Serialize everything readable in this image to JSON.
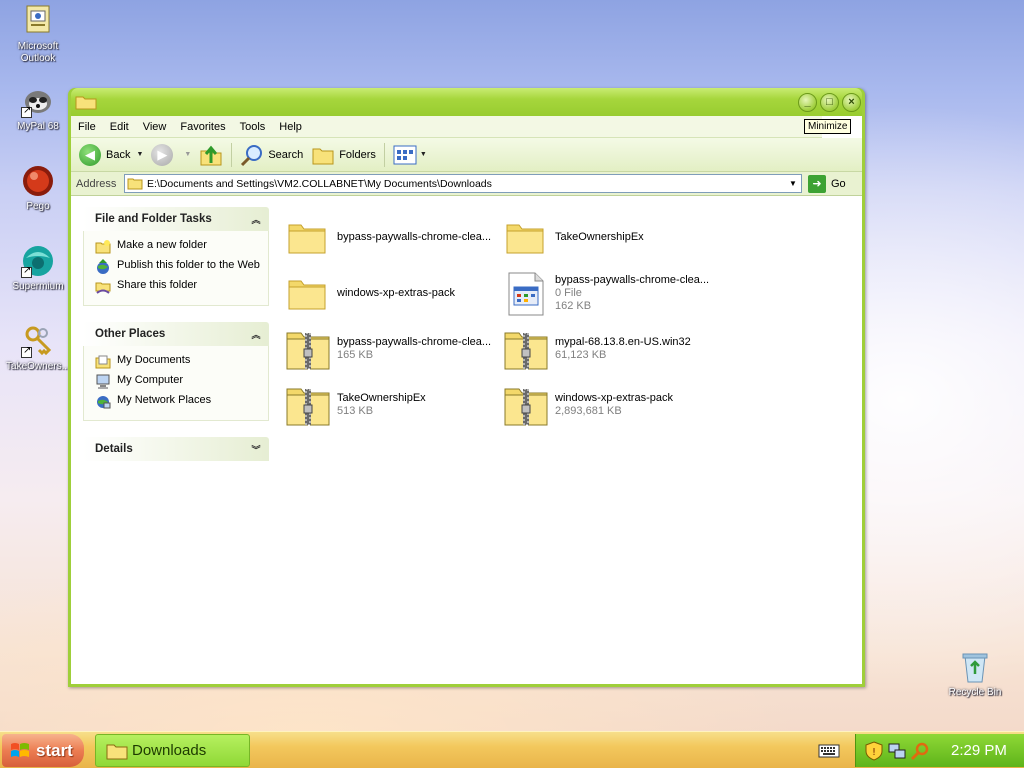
{
  "desktop": {
    "icons": [
      {
        "label": "Microsoft Outlook"
      },
      {
        "label": "MyPal 68"
      },
      {
        "label": "Pego"
      },
      {
        "label": "Supermium"
      },
      {
        "label": "TakeOwners..."
      },
      {
        "label": "Recycle Bin"
      }
    ]
  },
  "window": {
    "title": "",
    "tooltip": "Minimize",
    "menu": [
      "File",
      "Edit",
      "View",
      "Favorites",
      "Tools",
      "Help"
    ],
    "toolbar": {
      "back": "Back",
      "search": "Search",
      "folders": "Folders"
    },
    "address": {
      "label": "Address",
      "value": "E:\\Documents and Settings\\VM2.COLLABNET\\My Documents\\Downloads",
      "go": "Go"
    }
  },
  "taskpane": {
    "file_tasks": {
      "title": "File and Folder Tasks",
      "items": [
        "Make a new folder",
        "Publish this folder to the Web",
        "Share this folder"
      ]
    },
    "other_places": {
      "title": "Other Places",
      "items": [
        "My Documents",
        "My Computer",
        "My Network Places"
      ]
    },
    "details": {
      "title": "Details"
    }
  },
  "files": [
    {
      "name": "bypass-paywalls-chrome-clea...",
      "sub1": "",
      "sub2": "",
      "type": "folder"
    },
    {
      "name": "TakeOwnershipEx",
      "sub1": "",
      "sub2": "",
      "type": "folder"
    },
    {
      "name": "windows-xp-extras-pack",
      "sub1": "",
      "sub2": "",
      "type": "folder"
    },
    {
      "name": "bypass-paywalls-chrome-clea...",
      "sub1": "0 File",
      "sub2": "162 KB",
      "type": "file"
    },
    {
      "name": "bypass-paywalls-chrome-clea...",
      "sub1": "165 KB",
      "sub2": "",
      "type": "zip"
    },
    {
      "name": "mypal-68.13.8.en-US.win32",
      "sub1": "61,123 KB",
      "sub2": "",
      "type": "zip"
    },
    {
      "name": "TakeOwnershipEx",
      "sub1": "513 KB",
      "sub2": "",
      "type": "zip"
    },
    {
      "name": "windows-xp-extras-pack",
      "sub1": "2,893,681 KB",
      "sub2": "",
      "type": "zip"
    }
  ],
  "taskbar": {
    "start": "start",
    "task": "Downloads",
    "clock": "2:29 PM"
  }
}
